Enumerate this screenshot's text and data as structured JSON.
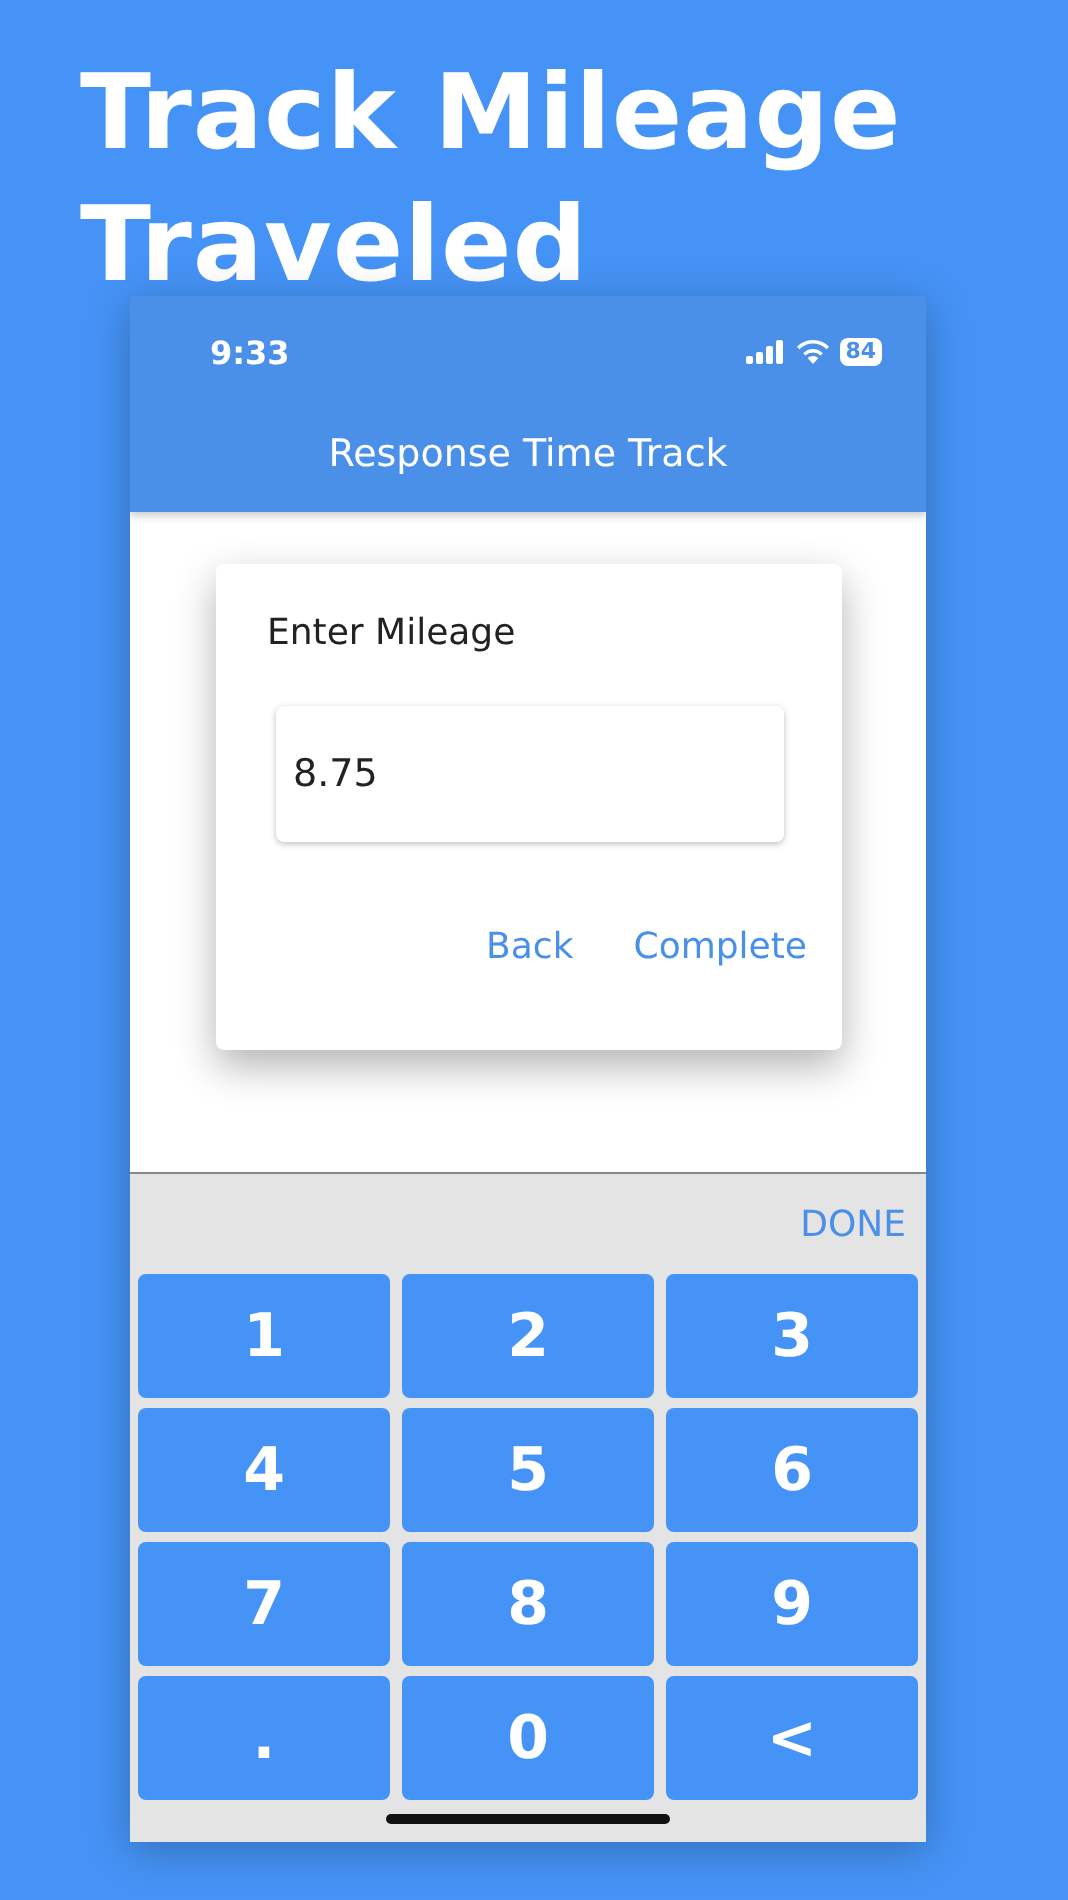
{
  "headline": "Track Mileage Traveled",
  "status_bar": {
    "time": "9:33",
    "battery": "84"
  },
  "app_bar": {
    "title": "Response Time Track"
  },
  "dialog": {
    "title": "Enter Mileage",
    "field": {
      "value": "8.75"
    },
    "buttons": [
      "Back",
      "Complete"
    ]
  },
  "keyboard": {
    "done": "DONE",
    "keys": [
      "1",
      "2",
      "3",
      "4",
      "5",
      "6",
      "7",
      "8",
      "9",
      ".",
      "0",
      "<"
    ]
  }
}
